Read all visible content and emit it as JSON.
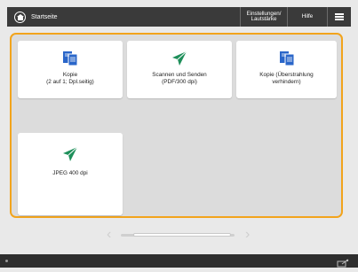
{
  "topbar": {
    "home_label": "Startseite",
    "settings_label": "Einstellungen/\nLautstärke",
    "help_label": "Hilfe",
    "icons": {
      "home": "home-icon",
      "menu": "menu-icon"
    }
  },
  "tiles": [
    {
      "label": "Kopie\n(2 auf 1; Dpl.seitig)",
      "icon": "copy-icon"
    },
    {
      "label": "Scannen und Senden\n(PDF/300 dpi)",
      "icon": "send-icon"
    },
    {
      "label": "Kopie (Überstrahlung\nverhindern)",
      "icon": "copy-icon"
    },
    {
      "label": "JPEG 400 dpi",
      "icon": "send-icon"
    }
  ],
  "colors": {
    "accent": "#f2a41c",
    "send_icon": "#1e8f5a",
    "copy_icon": "#2a66c9",
    "bar": "#3a3a3a"
  },
  "pager": {
    "prev": "‹",
    "next": "›"
  }
}
